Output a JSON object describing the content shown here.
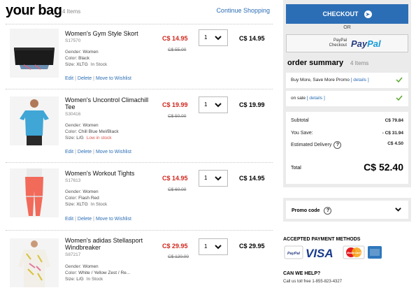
{
  "header": {
    "title": "your bag",
    "count": "4 Items",
    "continue_label": "Continue Shopping"
  },
  "items": [
    {
      "name": "Women's Gym Style Skort",
      "sku": "S17570",
      "gender": "Women",
      "color": "Black",
      "size": "XLTG",
      "stock": "In Stock",
      "stock_status": "in",
      "sale_price": "C$ 14.95",
      "orig_price": "C$ 55.00",
      "qty": "1",
      "total": "C$ 14.95",
      "image_icon": "skort-image"
    },
    {
      "name": "Women's Uncontrol Climachill Tee",
      "sku": "S30416",
      "gender": "Women",
      "color": "Chill Blue Mel/Black",
      "size": "L/G",
      "stock": "Low in stock",
      "stock_status": "low",
      "sale_price": "C$ 19.99",
      "orig_price": "C$ 50.00",
      "qty": "1",
      "total": "C$ 19.99",
      "image_icon": "tee-image"
    },
    {
      "name": "Women's Workout Tights",
      "sku": "S17613",
      "gender": "Women",
      "color": "Flash Red",
      "size": "XLTG",
      "stock": "In Stock",
      "stock_status": "in",
      "sale_price": "C$ 14.95",
      "orig_price": "C$ 60.00",
      "qty": "1",
      "total": "C$ 14.95",
      "image_icon": "tights-image"
    },
    {
      "name": "Women's adidas Stellasport Windbreaker",
      "sku": "S87217",
      "gender": "Women",
      "color": "White / Yellow Zest / Re...",
      "size": "L/G",
      "stock": "In Stock",
      "stock_status": "in",
      "sale_price": "C$ 29.95",
      "orig_price": "C$ 120.00",
      "qty": "1",
      "total": "C$ 29.95",
      "image_icon": "windbreaker-image"
    }
  ],
  "item_labels": {
    "gender": "Gender:",
    "color": "Color:",
    "size": "Size:",
    "edit": "Edit",
    "delete": "Delete",
    "wishlist": "Move to Wishlist"
  },
  "summary": {
    "checkout_label": "CHECKOUT",
    "or_label": "OR",
    "paypal_small": "PayPal Checkout",
    "paypal_big_a": "Pay",
    "paypal_big_b": "Pal",
    "title": "order summary",
    "count": "4 Items",
    "promo_rows": [
      {
        "text": "Buy More, Save More Promo",
        "details": "[ details ]"
      },
      {
        "text": "on sale",
        "details": "[ details ]"
      }
    ],
    "subtotal_label": "Subtotal",
    "subtotal_value": "C$ 79.84",
    "save_label": "You Save:",
    "save_value": "- C$ 31.94",
    "delivery_label": "Estimated Delivery",
    "delivery_value": "C$ 4.50",
    "total_label": "Total",
    "total_value": "C$ 52.40",
    "help_glyph": "?"
  },
  "promo_code": {
    "label": "Promo code"
  },
  "payment": {
    "title": "ACCEPTED PAYMENT METHODS",
    "visa": "VISA",
    "paypal_logo": "PayPal",
    "mastercard": "MasterCard"
  },
  "help": {
    "title": "CAN WE HELP?",
    "text": "Call us toll free 1-855-823-4327"
  },
  "colors": {
    "accent_blue": "#2c6eb5",
    "sale_red": "#d0271d",
    "check_green": "#5aa832",
    "panel_grey": "#ebebeb"
  }
}
